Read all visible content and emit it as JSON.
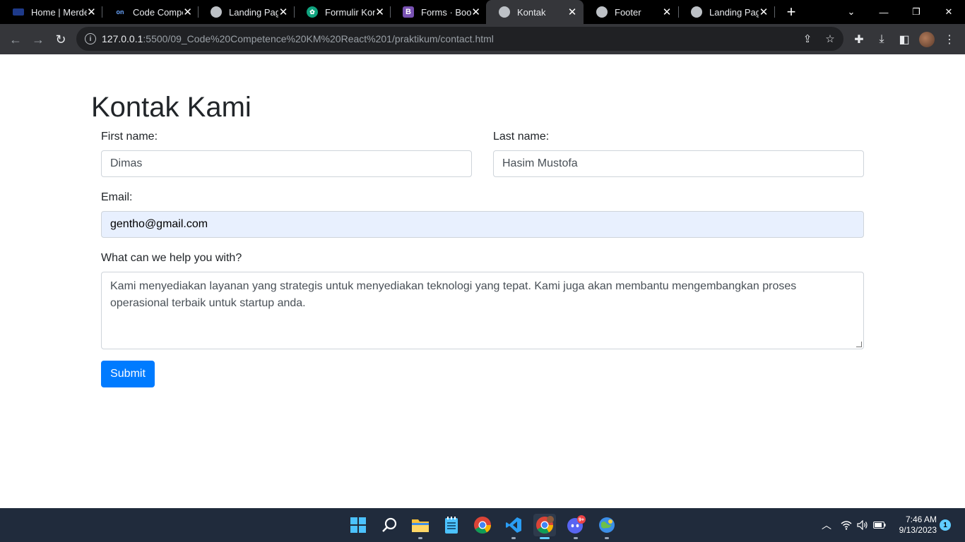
{
  "browser": {
    "tabs": [
      {
        "title": "Home | Merdeka",
        "favicon": "merdeka-icon"
      },
      {
        "title": "Code Competence",
        "favicon": "alterra-icon"
      },
      {
        "title": "Landing Page",
        "favicon": "globe-icon"
      },
      {
        "title": "Formulir Kontak",
        "favicon": "chatgpt-icon"
      },
      {
        "title": "Forms · Bootstrap",
        "favicon": "bootstrap-icon"
      },
      {
        "title": "Kontak",
        "favicon": "globe-icon",
        "active": true
      },
      {
        "title": "Footer",
        "favicon": "globe-icon"
      },
      {
        "title": "Landing Page",
        "favicon": "globe-icon"
      }
    ],
    "address": {
      "host": "127.0.0.1",
      "rest": ":5500/09_Code%20Competence%20KM%20React%201/praktikum/contact.html"
    }
  },
  "page": {
    "heading": "Kontak Kami",
    "first_name": {
      "label": "First name:",
      "value": "Dimas"
    },
    "last_name": {
      "label": "Last name:",
      "value": "Hasim Mustofa"
    },
    "email": {
      "label": "Email:",
      "value": "gentho@gmail.com"
    },
    "message": {
      "label": "What can we help you with?",
      "value": "Kami menyediakan layanan yang strategis untuk menyediakan teknologi yang tepat. Kami juga akan membantu mengembangkan proses operasional terbaik untuk startup anda."
    },
    "submit_label": "Submit"
  },
  "taskbar": {
    "time": "7:46 AM",
    "date": "9/13/2023",
    "discord_badge": "9+",
    "notification_count": "1"
  },
  "colors": {
    "primary": "#007bff",
    "autofill": "#e8f0fe",
    "taskbar": "#202b3c"
  }
}
